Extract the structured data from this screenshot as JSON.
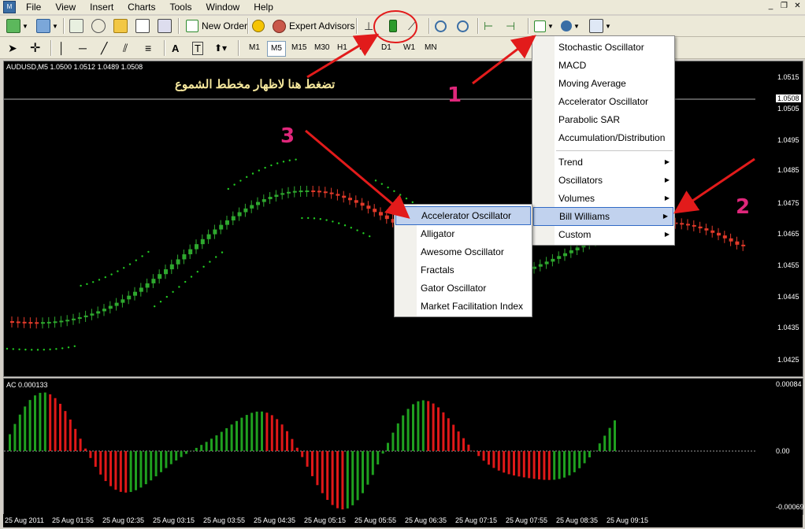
{
  "menubar": {
    "items": [
      "File",
      "View",
      "Insert",
      "Charts",
      "Tools",
      "Window",
      "Help"
    ],
    "window_controls": [
      "_",
      "❐",
      "✕"
    ]
  },
  "toolbar": {
    "new_order": "New Order",
    "expert_advisors": "Expert Advisors"
  },
  "timeframes": [
    "M1",
    "M5",
    "M15",
    "M30",
    "H1",
    "H4",
    "D1",
    "W1",
    "MN"
  ],
  "active_timeframe": "M5",
  "chart": {
    "symbol_info": "AUDUSD,M5  1.0500 1.0512 1.0489 1.0508",
    "price_labels": [
      "1.0515",
      "1.0505",
      "1.0495",
      "1.0485",
      "1.0475",
      "1.0465",
      "1.0455",
      "1.0445",
      "1.0435",
      "1.0425"
    ],
    "current_price": "1.0508",
    "annotation_arabic": "تضغط هنا لاظهار مخطط الشموع",
    "annotation_numbers": [
      "1",
      "2",
      "3"
    ]
  },
  "subwindow": {
    "label": "AC 0.000133",
    "scale_labels": [
      "0.00084",
      "0.00",
      "-0.00069"
    ]
  },
  "time_labels": [
    "25 Aug 2011",
    "25 Aug 01:55",
    "25 Aug 02:35",
    "25 Aug 03:15",
    "25 Aug 03:55",
    "25 Aug 04:35",
    "25 Aug 05:15",
    "25 Aug 05:55",
    "25 Aug 06:35",
    "25 Aug 07:15",
    "25 Aug 07:55",
    "25 Aug 08:35",
    "25 Aug 09:15"
  ],
  "indicators_menu": {
    "items": [
      "Stochastic Oscillator",
      "MACD",
      "Moving Average",
      "Accelerator Oscillator",
      "Parabolic SAR",
      "Accumulation/Distribution"
    ],
    "submenus": [
      "Trend",
      "Oscillators",
      "Volumes",
      "Bill Williams",
      "Custom"
    ],
    "highlighted": "Bill Williams"
  },
  "bill_williams_menu": {
    "items": [
      "Accelerator Oscillator",
      "Alligator",
      "Awesome Oscillator",
      "Fractals",
      "Gator Oscillator",
      "Market Facilitation Index"
    ],
    "highlighted": "Accelerator Oscillator"
  },
  "colors": {
    "bull": "#2ea82e",
    "bear": "#e23a2a",
    "sar": "#22cc22",
    "ac_up": "#1fa01f",
    "ac_down": "#e01818",
    "annotation_arrow": "#e21b1b",
    "annotation_number": "#e0277b",
    "annotation_text": "#f6e89d"
  }
}
